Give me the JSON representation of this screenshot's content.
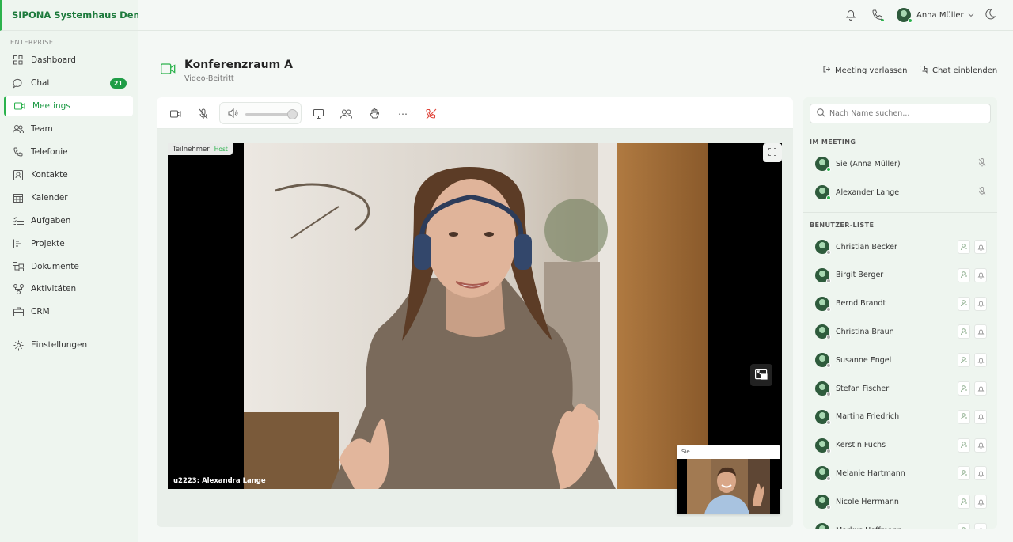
{
  "app": {
    "title": "SIPONA Systemhaus Demo..."
  },
  "sidebar": {
    "section_label": "ENTERPRISE",
    "items": [
      {
        "label": "Dashboard",
        "icon": "grid-icon"
      },
      {
        "label": "Chat",
        "icon": "chat-icon",
        "badge": "21"
      },
      {
        "label": "Meetings",
        "icon": "video-icon",
        "active": true
      },
      {
        "label": "Team",
        "icon": "team-icon"
      },
      {
        "label": "Telefonie",
        "icon": "phone-icon"
      },
      {
        "label": "Kontakte",
        "icon": "contacts-icon"
      },
      {
        "label": "Kalender",
        "icon": "calendar-icon"
      },
      {
        "label": "Aufgaben",
        "icon": "tasks-icon"
      },
      {
        "label": "Projekte",
        "icon": "projects-icon"
      },
      {
        "label": "Dokumente",
        "icon": "documents-icon"
      },
      {
        "label": "Aktivitäten",
        "icon": "activity-icon"
      },
      {
        "label": "CRM",
        "icon": "briefcase-icon"
      },
      {
        "label": "Einstellungen",
        "icon": "gear-icon"
      }
    ]
  },
  "topbar": {
    "user_name": "Anna Müller"
  },
  "page": {
    "title": "Konferenzraum A",
    "subtitle": "Video-Beitritt",
    "leave_label": "Meeting verlassen",
    "chat_label": "Chat einblenden"
  },
  "video": {
    "participants_label": "Teilnehmer",
    "host_label": "Host",
    "speaker_name": "u2223: Alexandra Lange",
    "self_label": "Sie",
    "volume": 1.0
  },
  "panel": {
    "search_placeholder": "Nach Name suchen...",
    "in_meeting_label": "IM MEETING",
    "in_meeting": [
      "Sie (Anna Müller)",
      "Alexander Lange"
    ],
    "user_list_label": "BENUTZER-LISTE",
    "users": [
      "Christian Becker",
      "Birgit Berger",
      "Bernd Brandt",
      "Christina Braun",
      "Susanne Engel",
      "Stefan Fischer",
      "Martina Friedrich",
      "Kerstin Fuchs",
      "Melanie Hartmann",
      "Nicole Herrmann",
      "Markus Hoffmann"
    ]
  },
  "colors": {
    "accent": "#2bb24c",
    "brand_text": "#1d7a3c",
    "hangup": "#e0463c"
  }
}
